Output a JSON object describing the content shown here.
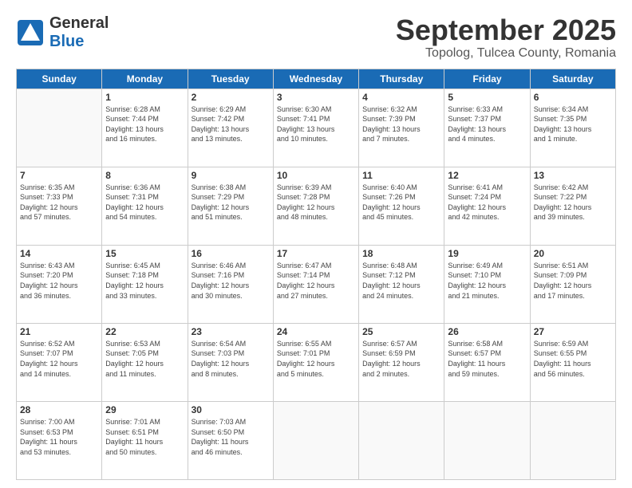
{
  "logo": {
    "general": "General",
    "blue": "Blue"
  },
  "title": "September 2025",
  "location": "Topolog, Tulcea County, Romania",
  "days_of_week": [
    "Sunday",
    "Monday",
    "Tuesday",
    "Wednesday",
    "Thursday",
    "Friday",
    "Saturday"
  ],
  "weeks": [
    [
      {
        "day": "",
        "info": ""
      },
      {
        "day": "1",
        "info": "Sunrise: 6:28 AM\nSunset: 7:44 PM\nDaylight: 13 hours\nand 16 minutes."
      },
      {
        "day": "2",
        "info": "Sunrise: 6:29 AM\nSunset: 7:42 PM\nDaylight: 13 hours\nand 13 minutes."
      },
      {
        "day": "3",
        "info": "Sunrise: 6:30 AM\nSunset: 7:41 PM\nDaylight: 13 hours\nand 10 minutes."
      },
      {
        "day": "4",
        "info": "Sunrise: 6:32 AM\nSunset: 7:39 PM\nDaylight: 13 hours\nand 7 minutes."
      },
      {
        "day": "5",
        "info": "Sunrise: 6:33 AM\nSunset: 7:37 PM\nDaylight: 13 hours\nand 4 minutes."
      },
      {
        "day": "6",
        "info": "Sunrise: 6:34 AM\nSunset: 7:35 PM\nDaylight: 13 hours\nand 1 minute."
      }
    ],
    [
      {
        "day": "7",
        "info": "Sunrise: 6:35 AM\nSunset: 7:33 PM\nDaylight: 12 hours\nand 57 minutes."
      },
      {
        "day": "8",
        "info": "Sunrise: 6:36 AM\nSunset: 7:31 PM\nDaylight: 12 hours\nand 54 minutes."
      },
      {
        "day": "9",
        "info": "Sunrise: 6:38 AM\nSunset: 7:29 PM\nDaylight: 12 hours\nand 51 minutes."
      },
      {
        "day": "10",
        "info": "Sunrise: 6:39 AM\nSunset: 7:28 PM\nDaylight: 12 hours\nand 48 minutes."
      },
      {
        "day": "11",
        "info": "Sunrise: 6:40 AM\nSunset: 7:26 PM\nDaylight: 12 hours\nand 45 minutes."
      },
      {
        "day": "12",
        "info": "Sunrise: 6:41 AM\nSunset: 7:24 PM\nDaylight: 12 hours\nand 42 minutes."
      },
      {
        "day": "13",
        "info": "Sunrise: 6:42 AM\nSunset: 7:22 PM\nDaylight: 12 hours\nand 39 minutes."
      }
    ],
    [
      {
        "day": "14",
        "info": "Sunrise: 6:43 AM\nSunset: 7:20 PM\nDaylight: 12 hours\nand 36 minutes."
      },
      {
        "day": "15",
        "info": "Sunrise: 6:45 AM\nSunset: 7:18 PM\nDaylight: 12 hours\nand 33 minutes."
      },
      {
        "day": "16",
        "info": "Sunrise: 6:46 AM\nSunset: 7:16 PM\nDaylight: 12 hours\nand 30 minutes."
      },
      {
        "day": "17",
        "info": "Sunrise: 6:47 AM\nSunset: 7:14 PM\nDaylight: 12 hours\nand 27 minutes."
      },
      {
        "day": "18",
        "info": "Sunrise: 6:48 AM\nSunset: 7:12 PM\nDaylight: 12 hours\nand 24 minutes."
      },
      {
        "day": "19",
        "info": "Sunrise: 6:49 AM\nSunset: 7:10 PM\nDaylight: 12 hours\nand 21 minutes."
      },
      {
        "day": "20",
        "info": "Sunrise: 6:51 AM\nSunset: 7:09 PM\nDaylight: 12 hours\nand 17 minutes."
      }
    ],
    [
      {
        "day": "21",
        "info": "Sunrise: 6:52 AM\nSunset: 7:07 PM\nDaylight: 12 hours\nand 14 minutes."
      },
      {
        "day": "22",
        "info": "Sunrise: 6:53 AM\nSunset: 7:05 PM\nDaylight: 12 hours\nand 11 minutes."
      },
      {
        "day": "23",
        "info": "Sunrise: 6:54 AM\nSunset: 7:03 PM\nDaylight: 12 hours\nand 8 minutes."
      },
      {
        "day": "24",
        "info": "Sunrise: 6:55 AM\nSunset: 7:01 PM\nDaylight: 12 hours\nand 5 minutes."
      },
      {
        "day": "25",
        "info": "Sunrise: 6:57 AM\nSunset: 6:59 PM\nDaylight: 12 hours\nand 2 minutes."
      },
      {
        "day": "26",
        "info": "Sunrise: 6:58 AM\nSunset: 6:57 PM\nDaylight: 11 hours\nand 59 minutes."
      },
      {
        "day": "27",
        "info": "Sunrise: 6:59 AM\nSunset: 6:55 PM\nDaylight: 11 hours\nand 56 minutes."
      }
    ],
    [
      {
        "day": "28",
        "info": "Sunrise: 7:00 AM\nSunset: 6:53 PM\nDaylight: 11 hours\nand 53 minutes."
      },
      {
        "day": "29",
        "info": "Sunrise: 7:01 AM\nSunset: 6:51 PM\nDaylight: 11 hours\nand 50 minutes."
      },
      {
        "day": "30",
        "info": "Sunrise: 7:03 AM\nSunset: 6:50 PM\nDaylight: 11 hours\nand 46 minutes."
      },
      {
        "day": "",
        "info": ""
      },
      {
        "day": "",
        "info": ""
      },
      {
        "day": "",
        "info": ""
      },
      {
        "day": "",
        "info": ""
      }
    ]
  ]
}
